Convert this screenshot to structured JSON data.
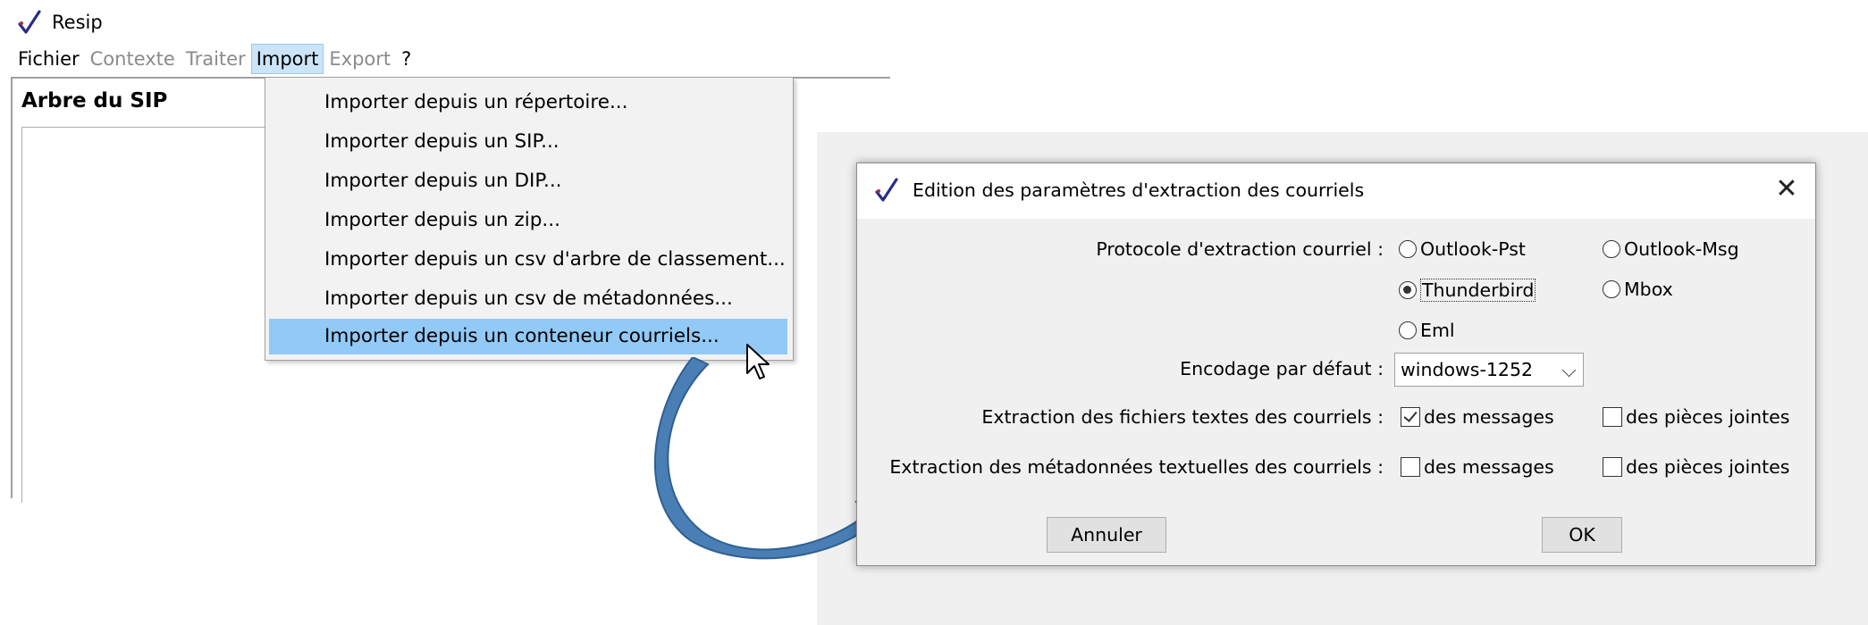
{
  "app": {
    "title": "Resip",
    "logo_color": "#2b2b8a"
  },
  "menubar": {
    "items": [
      {
        "label": "Fichier",
        "state": "enabled"
      },
      {
        "label": "Contexte",
        "state": "disabled"
      },
      {
        "label": "Traiter",
        "state": "disabled"
      },
      {
        "label": "Import",
        "state": "active"
      },
      {
        "label": "Export",
        "state": "disabled"
      },
      {
        "label": "?",
        "state": "enabled"
      }
    ]
  },
  "tree_panel": {
    "title": "Arbre du SIP"
  },
  "import_menu": {
    "items": [
      "Importer depuis un répertoire...",
      "Importer depuis un SIP...",
      "Importer depuis un DIP...",
      "Importer depuis un zip...",
      "Importer depuis un csv d'arbre de classement...",
      "Importer depuis un csv de métadonnées...",
      "Importer depuis un conteneur courriels..."
    ],
    "highlighted_index": 6,
    "highlight_color": "#91c9f7"
  },
  "arrow": {
    "color": "#4a7fb5",
    "icon": "curved-arrow-icon"
  },
  "dialog": {
    "title": "Edition des paramètres d'extraction des courriels",
    "close_glyph": "✕",
    "protocol": {
      "label": "Protocole d'extraction courriel :",
      "options": [
        "Outlook-Pst",
        "Outlook-Msg",
        "Thunderbird",
        "Mbox",
        "Eml"
      ],
      "selected": "Thunderbird"
    },
    "encoding": {
      "label": "Encodage par défaut :",
      "value": "windows-1252"
    },
    "text_files": {
      "label": "Extraction des fichiers textes des courriels :",
      "messages_label": "des messages",
      "messages_checked": true,
      "attachments_label": "des pièces jointes",
      "attachments_checked": false
    },
    "text_metadata": {
      "label": "Extraction des métadonnées textuelles des courriels :",
      "messages_label": "des messages",
      "messages_checked": false,
      "attachments_label": "des pièces jointes",
      "attachments_checked": false
    },
    "cancel_label": "Annuler",
    "ok_label": "OK"
  }
}
